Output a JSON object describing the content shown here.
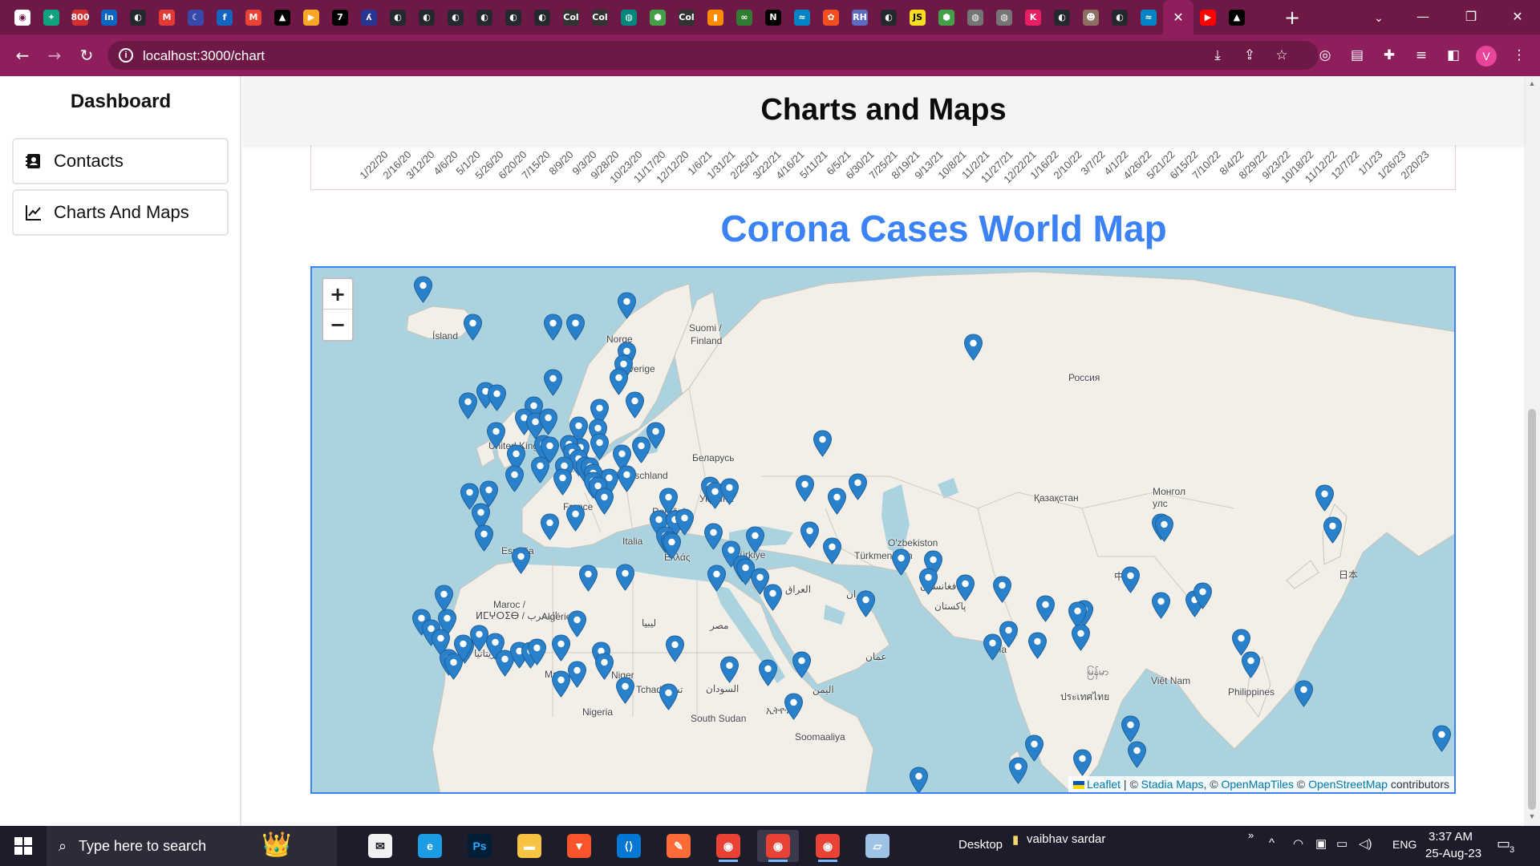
{
  "browser": {
    "tabs": [
      {
        "icon": "chrome-icon",
        "color": "#ffffff",
        "glyph": "◉"
      },
      {
        "icon": "chatgpt-icon",
        "color": "#10a37f",
        "glyph": "✦"
      },
      {
        "icon": "badge-800-icon",
        "color": "#d32f2f",
        "glyph": "800"
      },
      {
        "icon": "linkedin-icon",
        "color": "#0a66c2",
        "glyph": "in"
      },
      {
        "icon": "github-icon",
        "color": "#24292f",
        "glyph": "◐"
      },
      {
        "icon": "m-icon",
        "color": "#e53935",
        "glyph": "M"
      },
      {
        "icon": "arc-icon",
        "color": "#3949ab",
        "glyph": "☾"
      },
      {
        "icon": "f-icon",
        "color": "#1565c0",
        "glyph": "f"
      },
      {
        "icon": "gmail-icon",
        "color": "#ea4335",
        "glyph": "M"
      },
      {
        "icon": "vercel-icon",
        "color": "#000000",
        "glyph": "▲"
      },
      {
        "icon": "play-icon",
        "color": "#f9a825",
        "glyph": "▶"
      },
      {
        "icon": "seven-icon",
        "color": "#000000",
        "glyph": "7"
      },
      {
        "icon": "figure-icon",
        "color": "#283593",
        "glyph": "ʎ"
      },
      {
        "icon": "github-icon",
        "color": "#24292f",
        "glyph": "◐"
      },
      {
        "icon": "github-icon",
        "color": "#24292f",
        "glyph": "◐"
      },
      {
        "icon": "github-icon",
        "color": "#24292f",
        "glyph": "◐"
      },
      {
        "icon": "github-icon",
        "color": "#24292f",
        "glyph": "◐"
      },
      {
        "icon": "github-icon",
        "color": "#24292f",
        "glyph": "◐"
      },
      {
        "icon": "github-icon",
        "color": "#24292f",
        "glyph": "◐"
      },
      {
        "icon": "codeium-icon",
        "color": "#333333",
        "glyph": "Col"
      },
      {
        "icon": "codeium-icon",
        "color": "#333333",
        "glyph": "Col"
      },
      {
        "icon": "world-icon",
        "color": "#00897b",
        "glyph": "◍"
      },
      {
        "icon": "node-icon",
        "color": "#43a047",
        "glyph": "⬢"
      },
      {
        "icon": "codeium-icon",
        "color": "#333333",
        "glyph": "Col"
      },
      {
        "icon": "chart-icon",
        "color": "#fb8c00",
        "glyph": "▮"
      },
      {
        "icon": "infinity-icon",
        "color": "#2e7d32",
        "glyph": "∞"
      },
      {
        "icon": "n-icon",
        "color": "#000000",
        "glyph": "N"
      },
      {
        "icon": "tailwind-icon",
        "color": "#0284c7",
        "glyph": "≈"
      },
      {
        "icon": "figma-icon",
        "color": "#f24e1e",
        "glyph": "✿"
      },
      {
        "icon": "rh-icon",
        "color": "#5c6bc0",
        "glyph": "RH"
      },
      {
        "icon": "github-icon",
        "color": "#24292f",
        "glyph": "◐"
      },
      {
        "icon": "js-icon",
        "color": "#f7df1e",
        "glyph": "JS"
      },
      {
        "icon": "node-icon",
        "color": "#43a047",
        "glyph": "⬢"
      },
      {
        "icon": "globe-icon",
        "color": "#757575",
        "glyph": "◍"
      },
      {
        "icon": "globe-icon",
        "color": "#757575",
        "glyph": "◍"
      },
      {
        "icon": "k-icon",
        "color": "#e91e63",
        "glyph": "K"
      },
      {
        "icon": "github-icon",
        "color": "#24292f",
        "glyph": "◐"
      },
      {
        "icon": "avatar-icon",
        "color": "#8d6e63",
        "glyph": "☻"
      },
      {
        "icon": "github-icon",
        "color": "#24292f",
        "glyph": "◐"
      },
      {
        "icon": "tailwind-icon",
        "color": "#0284c7",
        "glyph": "≈"
      },
      {
        "icon": "close-icon",
        "color": "#ffffff",
        "glyph": "✕",
        "active": true
      },
      {
        "icon": "youtube-icon",
        "color": "#ff0000",
        "glyph": "▶"
      },
      {
        "icon": "vercel-icon",
        "color": "#000000",
        "glyph": "▲"
      }
    ],
    "url": "localhost:3000/chart"
  },
  "sidebar": {
    "title": "Dashboard",
    "items": [
      {
        "label": "Contacts",
        "icon": "contacts-icon"
      },
      {
        "label": "Charts And Maps",
        "icon": "line-chart-icon"
      }
    ]
  },
  "header": {
    "title": "Charts and Maps"
  },
  "chart": {
    "x_ticks": [
      "1/22/20",
      "2/16/20",
      "3/12/20",
      "4/6/20",
      "5/1/20",
      "5/26/20",
      "6/20/20",
      "7/15/20",
      "8/9/20",
      "9/3/20",
      "9/28/20",
      "10/23/20",
      "11/17/20",
      "12/12/20",
      "1/6/21",
      "1/31/21",
      "2/25/21",
      "3/22/21",
      "4/16/21",
      "5/11/21",
      "6/5/21",
      "6/30/21",
      "7/25/21",
      "8/19/21",
      "9/13/21",
      "10/8/21",
      "11/2/21",
      "11/27/21",
      "12/22/21",
      "1/16/22",
      "2/10/22",
      "3/7/22",
      "4/1/22",
      "4/26/22",
      "5/21/22",
      "6/15/22",
      "7/10/22",
      "8/4/22",
      "8/29/22",
      "9/23/22",
      "10/18/22",
      "11/12/22",
      "12/7/22",
      "1/1/23",
      "1/26/23",
      "2/20/23"
    ]
  },
  "map": {
    "title": "Corona Cases World Map",
    "zoom_in": "+",
    "zoom_out": "−",
    "attribution": {
      "leaflet": "Leaflet",
      "sep1": " | © ",
      "stadia": "Stadia Maps",
      "sep2": ", © ",
      "omt": "OpenMapTiles",
      "sep3": " © ",
      "osm": "OpenStreetMap",
      "tail": " contributors"
    },
    "labels": [
      {
        "text": "Ísland"
      },
      {
        "text": "Norge"
      },
      {
        "text": "Suomi /"
      },
      {
        "text": "Finland"
      },
      {
        "text": "Sverige"
      },
      {
        "text": "Россия"
      },
      {
        "text": "United Kingdom"
      },
      {
        "text": "Беларусь"
      },
      {
        "text": "Deutschland"
      },
      {
        "text": "Україна"
      },
      {
        "text": "France"
      },
      {
        "text": "Қазақстан"
      },
      {
        "text": "Монгол"
      },
      {
        "text": "улс"
      },
      {
        "text": "España"
      },
      {
        "text": "Italia"
      },
      {
        "text": "România"
      },
      {
        "text": "Ελλάς"
      },
      {
        "text": "Türkiye"
      },
      {
        "text": "O'zbekiston"
      },
      {
        "text": "Türkmenistan"
      },
      {
        "text": "中国"
      },
      {
        "text": "日本"
      },
      {
        "text": "العراق"
      },
      {
        "text": "ایران"
      },
      {
        "text": "افغانستان"
      },
      {
        "text": "پاکستان"
      },
      {
        "text": "Maroc /"
      },
      {
        "text": "ⵍⵎⵖⵔⵉⴱ / المغرب"
      },
      {
        "text": "Algérie"
      },
      {
        "text": "ليبيا"
      },
      {
        "text": "مصر"
      },
      {
        "text": "عمان"
      },
      {
        "text": "India"
      },
      {
        "text": "موريتانيا"
      },
      {
        "text": "Mali"
      },
      {
        "text": "Niger"
      },
      {
        "text": "Tchad تشاد"
      },
      {
        "text": "السودان"
      },
      {
        "text": "اليمن"
      },
      {
        "text": "ประเทศไทย"
      },
      {
        "text": "Việt Nam"
      },
      {
        "text": "Philippines"
      },
      {
        "text": "Nigeria"
      },
      {
        "text": "South Sudan"
      },
      {
        "text": "ኢትዮጵያ"
      },
      {
        "text": "Soomaaliya"
      },
      {
        "text": "မြန်မာ"
      }
    ],
    "marker_count": 130,
    "marker_color": "#2a81cb"
  },
  "taskbar": {
    "search_placeholder": "Type here to search",
    "desktop_label": "Desktop",
    "user_label": "vaibhav sardar",
    "lang": "ENG",
    "time": "3:37 AM",
    "date": "25-Aug-23",
    "notif_count": "3",
    "apps": [
      {
        "name": "mail",
        "color": "#f2f2f2",
        "glyph": "✉"
      },
      {
        "name": "edge",
        "color": "#1b9ce3",
        "glyph": "e"
      },
      {
        "name": "photoshop",
        "color": "#001e36",
        "glyph": "Ps"
      },
      {
        "name": "explorer",
        "color": "#f6c343",
        "glyph": "▬"
      },
      {
        "name": "brave",
        "color": "#fb542b",
        "glyph": "▼"
      },
      {
        "name": "vscode",
        "color": "#0078d4",
        "glyph": "⟨⟩"
      },
      {
        "name": "postman",
        "color": "#ff6c37",
        "glyph": "✎"
      },
      {
        "name": "chrome",
        "color": "#e94235",
        "glyph": "◉"
      },
      {
        "name": "chrome-profile",
        "color": "#e94235",
        "glyph": "◉"
      },
      {
        "name": "chrome-profile-2",
        "color": "#e94235",
        "glyph": "◉"
      },
      {
        "name": "notes",
        "color": "#9ec3e6",
        "glyph": "▱"
      }
    ]
  }
}
